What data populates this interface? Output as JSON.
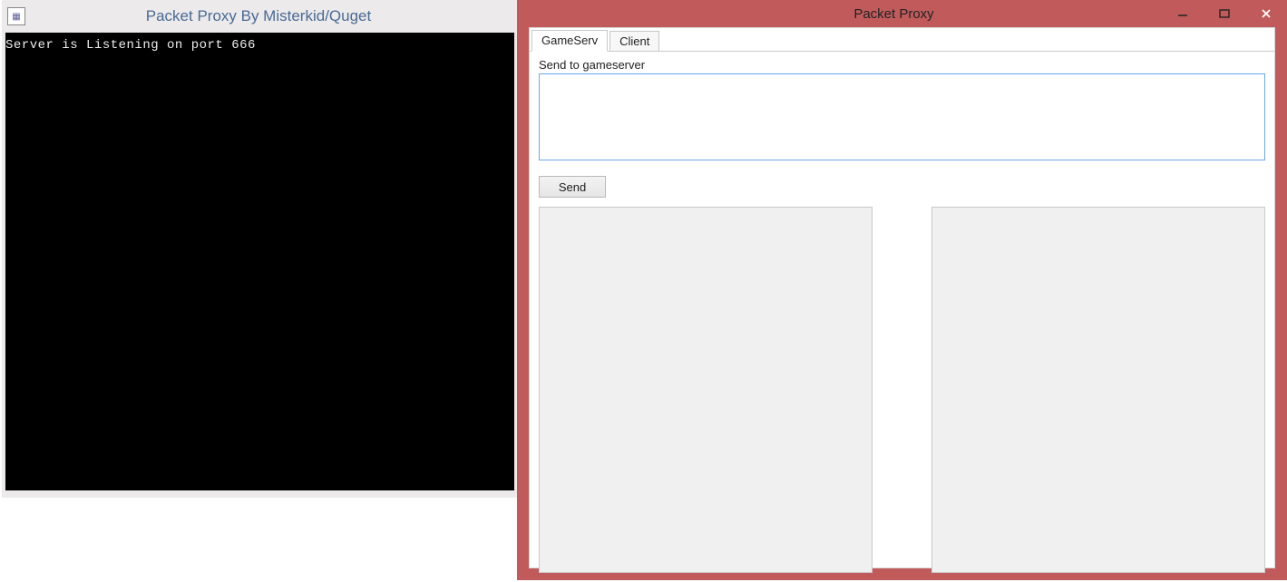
{
  "console": {
    "title": "Packet Proxy By Misterkid/Quget",
    "output": "Server is Listening on port 666"
  },
  "proxy": {
    "title": "Packet Proxy",
    "tabs": [
      {
        "label": "GameServ",
        "active": true
      },
      {
        "label": "Client",
        "active": false
      }
    ],
    "send_label": "Send to gameserver",
    "send_button": "Send",
    "input_value": ""
  }
}
